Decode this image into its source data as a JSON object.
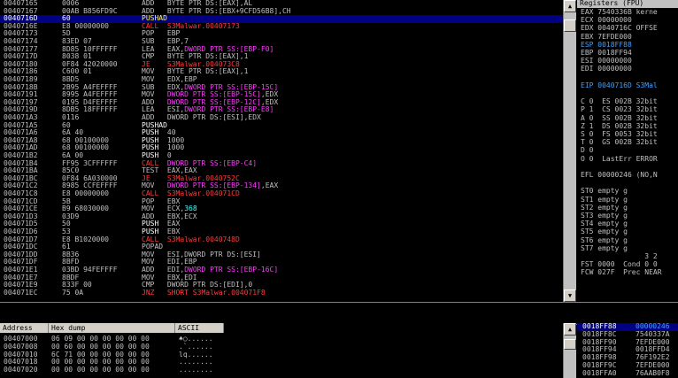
{
  "disasm": [
    {
      "addr": "00407165",
      "hex": "0006",
      "mn": "ADD",
      "ops": [
        {
          "t": "BYTE PTR DS:[EAX],AL",
          "c": "t-c"
        }
      ],
      "k": "k-add"
    },
    {
      "addr": "00407167",
      "hex": "00AB B856FD9C",
      "mn": "ADD",
      "ops": [
        {
          "t": "BYTE PTR DS:[EBX+9CFD56B8],CH",
          "c": "t-c"
        }
      ],
      "k": "k-add"
    },
    {
      "addr": "0040716D",
      "hex": "60",
      "mn": "PUSHAD",
      "ops": [],
      "k": "k-push",
      "sel": true
    },
    {
      "addr": "0040716E",
      "hex": "E8 00000000",
      "mn": "CALL",
      "ops": [
        {
          "t": "S3Malwar.00407173",
          "c": "t-r"
        }
      ],
      "k": "k-call"
    },
    {
      "addr": "00407173",
      "hex": "5D",
      "mn": "POP",
      "ops": [
        {
          "t": "EBP",
          "c": "t-c"
        }
      ],
      "k": "k-pop"
    },
    {
      "addr": "00407174",
      "hex": "83ED 07",
      "mn": "SUB",
      "ops": [
        {
          "t": "EBP,7",
          "c": "t-c"
        }
      ],
      "k": "k-sub"
    },
    {
      "addr": "00407177",
      "hex": "8D85 10FFFFFF",
      "mn": "LEA",
      "ops": [
        {
          "t": "EAX,",
          "c": "t-c"
        },
        {
          "t": "DWORD PTR SS:[EBP-F0]",
          "c": "t-m"
        }
      ],
      "k": "k-lea"
    },
    {
      "addr": "0040717D",
      "hex": "8038 01",
      "mn": "CMP",
      "ops": [
        {
          "t": "BYTE PTR DS:[EAX],1",
          "c": "t-c"
        }
      ],
      "k": "k-cmp"
    },
    {
      "addr": "00407180",
      "hex": "0F84 42020000",
      "mn": "JE",
      "ops": [
        {
          "t": "S3Malwar.004073C8",
          "c": "t-r"
        }
      ],
      "k": "k-jmp"
    },
    {
      "addr": "00407186",
      "hex": "C600 01",
      "mn": "MOV",
      "ops": [
        {
          "t": "BYTE PTR DS:[EAX],1",
          "c": "t-c"
        }
      ],
      "k": "k-mov"
    },
    {
      "addr": "00407189",
      "hex": "8BD5",
      "mn": "MOV",
      "ops": [
        {
          "t": "EDX,EBP",
          "c": "t-c"
        }
      ],
      "k": "k-mov"
    },
    {
      "addr": "0040718B",
      "hex": "2B95 A4FEFFFF",
      "mn": "SUB",
      "ops": [
        {
          "t": "EDX,",
          "c": "t-c"
        },
        {
          "t": "DWORD PTR SS:[EBP-15C]",
          "c": "t-m"
        }
      ],
      "k": "k-sub"
    },
    {
      "addr": "00407191",
      "hex": "8995 A4FEFFFF",
      "mn": "MOV",
      "ops": [
        {
          "t": "DWORD PTR SS:[EBP-15C]",
          "c": "t-m"
        },
        {
          "t": ",EDX",
          "c": "t-c"
        }
      ],
      "k": "k-mov"
    },
    {
      "addr": "00407197",
      "hex": "0195 D4FEFFFF",
      "mn": "ADD",
      "ops": [
        {
          "t": "DWORD PTR SS:[EBP-12C]",
          "c": "t-m"
        },
        {
          "t": ",EDX",
          "c": "t-c"
        }
      ],
      "k": "k-add"
    },
    {
      "addr": "0040719D",
      "hex": "8DB5 18FFFFFF",
      "mn": "LEA",
      "ops": [
        {
          "t": "ESI,",
          "c": "t-c"
        },
        {
          "t": "DWORD PTR SS:[EBP-E8]",
          "c": "t-m"
        }
      ],
      "k": "k-lea"
    },
    {
      "addr": "004071A3",
      "hex": "0116",
      "mn": "ADD",
      "ops": [
        {
          "t": "DWORD PTR DS:[ESI],EDX",
          "c": "t-c"
        }
      ],
      "k": "k-add"
    },
    {
      "addr": "004071A5",
      "hex": "60",
      "mn": "PUSHAD",
      "ops": [],
      "k": "k-push"
    },
    {
      "addr": "004071A6",
      "hex": "6A 40",
      "mn": "PUSH",
      "ops": [
        {
          "t": "40",
          "c": "t-c"
        }
      ],
      "k": "k-push"
    },
    {
      "addr": "004071A8",
      "hex": "68 00100000",
      "mn": "PUSH",
      "ops": [
        {
          "t": "1000",
          "c": "t-c"
        }
      ],
      "k": "k-push"
    },
    {
      "addr": "004071AD",
      "hex": "68 00100000",
      "mn": "PUSH",
      "ops": [
        {
          "t": "1000",
          "c": "t-c"
        }
      ],
      "k": "k-push"
    },
    {
      "addr": "004071B2",
      "hex": "6A 00",
      "mn": "PUSH",
      "ops": [
        {
          "t": "0",
          "c": "t-c"
        }
      ],
      "k": "k-push"
    },
    {
      "addr": "004071B4",
      "hex": "FF95 3CFFFFFF",
      "mn": "CALL",
      "ops": [
        {
          "t": "DWORD PTR SS:[EBP-C4]",
          "c": "t-m"
        }
      ],
      "k": "k-call"
    },
    {
      "addr": "004071BA",
      "hex": "85C0",
      "mn": "TEST",
      "ops": [
        {
          "t": "EAX,EAX",
          "c": "t-c"
        }
      ],
      "k": "k-test"
    },
    {
      "addr": "004071BC",
      "hex": "0F84 6A030000",
      "mn": "JE",
      "ops": [
        {
          "t": "S3Malwar.0040752C",
          "c": "t-r"
        }
      ],
      "k": "k-jmp"
    },
    {
      "addr": "004071C2",
      "hex": "8985 CCFEFFFF",
      "mn": "MOV",
      "ops": [
        {
          "t": "DWORD PTR SS:[EBP-134]",
          "c": "t-m"
        },
        {
          "t": ",EAX",
          "c": "t-c"
        }
      ],
      "k": "k-mov"
    },
    {
      "addr": "004071C8",
      "hex": "E8 00000000",
      "mn": "CALL",
      "ops": [
        {
          "t": "S3Malwar.004071CD",
          "c": "t-r"
        }
      ],
      "k": "k-call"
    },
    {
      "addr": "004071CD",
      "hex": "5B",
      "mn": "POP",
      "ops": [
        {
          "t": "EBX",
          "c": "t-c"
        }
      ],
      "k": "k-pop"
    },
    {
      "addr": "004071CE",
      "hex": "B9 68030000",
      "mn": "MOV",
      "ops": [
        {
          "t": "ECX,",
          "c": "t-c"
        },
        {
          "t": "368",
          "c": "t-cy"
        }
      ],
      "k": "k-mov"
    },
    {
      "addr": "004071D3",
      "hex": "03D9",
      "mn": "ADD",
      "ops": [
        {
          "t": "EBX,ECX",
          "c": "t-c"
        }
      ],
      "k": "k-add"
    },
    {
      "addr": "004071D5",
      "hex": "50",
      "mn": "PUSH",
      "ops": [
        {
          "t": "EAX",
          "c": "t-c"
        }
      ],
      "k": "k-push"
    },
    {
      "addr": "004071D6",
      "hex": "53",
      "mn": "PUSH",
      "ops": [
        {
          "t": "EBX",
          "c": "t-c"
        }
      ],
      "k": "k-push"
    },
    {
      "addr": "004071D7",
      "hex": "E8 B1020000",
      "mn": "CALL",
      "ops": [
        {
          "t": "S3Malwar.0040748D",
          "c": "t-r"
        }
      ],
      "k": "k-call"
    },
    {
      "addr": "004071DC",
      "hex": "61",
      "mn": "POPAD",
      "ops": [],
      "k": "k-pop"
    },
    {
      "addr": "004071DD",
      "hex": "8B36",
      "mn": "MOV",
      "ops": [
        {
          "t": "ESI,DWORD PTR DS:[ESI]",
          "c": "t-c"
        }
      ],
      "k": "k-mov"
    },
    {
      "addr": "004071DF",
      "hex": "8BFD",
      "mn": "MOV",
      "ops": [
        {
          "t": "EDI,EBP",
          "c": "t-c"
        }
      ],
      "k": "k-mov"
    },
    {
      "addr": "004071E1",
      "hex": "03BD 94FEFFFF",
      "mn": "ADD",
      "ops": [
        {
          "t": "EDI,",
          "c": "t-c"
        },
        {
          "t": "DWORD PTR SS:[EBP-16C]",
          "c": "t-m"
        }
      ],
      "k": "k-add"
    },
    {
      "addr": "004071E7",
      "hex": "8BDF",
      "mn": "MOV",
      "ops": [
        {
          "t": "EBX,EDI",
          "c": "t-c"
        }
      ],
      "k": "k-mov"
    },
    {
      "addr": "004071E9",
      "hex": "833F 00",
      "mn": "CMP",
      "ops": [
        {
          "t": "DWORD PTR DS:[EDI],0",
          "c": "t-c"
        }
      ],
      "k": "k-cmp"
    },
    {
      "addr": "004071EC",
      "hex": "75 0A",
      "mn": "JNZ",
      "ops": [
        {
          "t": "SHORT S3Malwar.004071F8",
          "c": "t-r"
        }
      ],
      "k": "k-jmp"
    }
  ],
  "regs": {
    "title": "Registers (FPU)",
    "lines": [
      {
        "t": "EAX 7540336B kerne",
        "hl": false
      },
      {
        "t": "ECX 00000000",
        "hl": false
      },
      {
        "t": "EDX 0040716C OFFSE",
        "hl": false
      },
      {
        "t": "EBX 7EFDE000",
        "hl": false
      },
      {
        "t": "ESP 0018FF88",
        "hl": true
      },
      {
        "t": "EBP 0018FF94",
        "hl": false
      },
      {
        "t": "ESI 00000000",
        "hl": false
      },
      {
        "t": "EDI 00000000",
        "hl": false
      },
      {
        "t": "",
        "hl": false
      },
      {
        "t": "EIP 0040716D S3Mal",
        "hl": true
      },
      {
        "t": "",
        "hl": false
      },
      {
        "t": "C 0  ES 002B 32bit",
        "hl": false
      },
      {
        "t": "P 1  CS 0023 32bit",
        "hl": false
      },
      {
        "t": "A 0  SS 002B 32bit",
        "hl": false
      },
      {
        "t": "Z 1  DS 002B 32bit",
        "hl": false
      },
      {
        "t": "S 0  FS 0053 32bit",
        "hl": false
      },
      {
        "t": "T 0  GS 002B 32bit",
        "hl": false
      },
      {
        "t": "D 0",
        "hl": false
      },
      {
        "t": "O 0  LastErr ERROR",
        "hl": false
      },
      {
        "t": "",
        "hl": false
      },
      {
        "t": "EFL 00000246 (NO,N",
        "hl": false
      },
      {
        "t": "",
        "hl": false
      },
      {
        "t": "ST0 empty g",
        "hl": false
      },
      {
        "t": "ST1 empty g",
        "hl": false
      },
      {
        "t": "ST2 empty g",
        "hl": false
      },
      {
        "t": "ST3 empty g",
        "hl": false
      },
      {
        "t": "ST4 empty g",
        "hl": false
      },
      {
        "t": "ST5 empty g",
        "hl": false
      },
      {
        "t": "ST6 empty g",
        "hl": false
      },
      {
        "t": "ST7 empty g",
        "hl": false
      },
      {
        "t": "               3 2",
        "hl": false
      },
      {
        "t": "FST 0000  Cond 0 0",
        "hl": false
      },
      {
        "t": "FCW 027F  Prec NEAR",
        "hl": false
      }
    ]
  },
  "dump": {
    "headers": [
      "Address",
      "Hex dump",
      "ASCII"
    ],
    "rows": [
      {
        "addr": "00407000",
        "hex": "06 09 00 00 00 00 00 00",
        "ascii": "♠○......"
      },
      {
        "addr": "00407008",
        "hex": "00 60 00 00 00 00 00 00",
        "ascii": ".`......"
      },
      {
        "addr": "00407010",
        "hex": "6C 71 00 00 00 00 00 00",
        "ascii": "lq......"
      },
      {
        "addr": "00407018",
        "hex": "00 00 00 00 00 00 00 00",
        "ascii": "........"
      },
      {
        "addr": "00407020",
        "hex": "00 00 00 00 00 00 00 00",
        "ascii": "........"
      }
    ]
  },
  "stack": {
    "rows": [
      {
        "addr": "0018FF88",
        "val": "00000246",
        "sel": true
      },
      {
        "addr": "0018FF8C",
        "val": "7540337A",
        "sel": false
      },
      {
        "addr": "0018FF90",
        "val": "7EFDE000",
        "sel": false
      },
      {
        "addr": "0018FF94",
        "val": "0018FFD4",
        "sel": false
      },
      {
        "addr": "0018FF98",
        "val": "76F192E2",
        "sel": false
      },
      {
        "addr": "0018FF9C",
        "val": "7EFDE000",
        "sel": false
      },
      {
        "addr": "0018FFA0",
        "val": "76AAB0F8",
        "sel": false
      }
    ]
  }
}
